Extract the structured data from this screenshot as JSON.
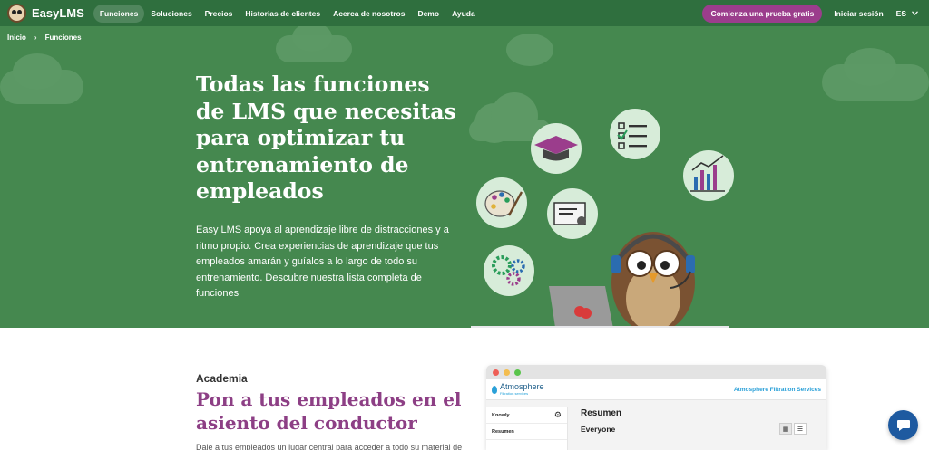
{
  "nav": {
    "brand": "EasyLMS",
    "items": [
      {
        "label": "Funciones",
        "active": true
      },
      {
        "label": "Soluciones"
      },
      {
        "label": "Precios"
      },
      {
        "label": "Historias de clientes"
      },
      {
        "label": "Acerca de nosotros"
      },
      {
        "label": "Demo"
      },
      {
        "label": "Ayuda"
      }
    ],
    "cta": "Comienza una prueba gratis",
    "login": "Iniciar sesión",
    "lang": "ES"
  },
  "breadcrumb": {
    "home": "Inicio",
    "current": "Funciones"
  },
  "hero": {
    "title": "Todas las funciones de LMS que necesitas para optimizar tu entrenamiento de empleados",
    "description": "Easy LMS apoya al aprendizaje libre de distracciones y a ritmo propio. Crea experiencias de aprendizaje que tus empleados amarán y guíalos a lo largo de todo su entrenamiento. Descubre nuestra lista completa de funciones"
  },
  "section": {
    "label": "Academia",
    "title": "Pon a tus empleados en el asiento del conductor",
    "description": "Dale a tus empleados un lugar central para acceder a todo su material de"
  },
  "mockup": {
    "brand_name": "Atmosphere",
    "brand_sub": "Filtration services",
    "company": "Atmosphere Filtration Services",
    "sidebar": [
      {
        "label": "Knowly"
      },
      {
        "label": "Resumen"
      }
    ],
    "main_title": "Resumen",
    "main_sub": "Everyone"
  },
  "colors": {
    "nav_bg": "#2f6f3e",
    "hero_bg": "#45884f",
    "cta": "#9b3d8c",
    "section_title": "#8d3f85",
    "chat": "#1e5aa0"
  }
}
